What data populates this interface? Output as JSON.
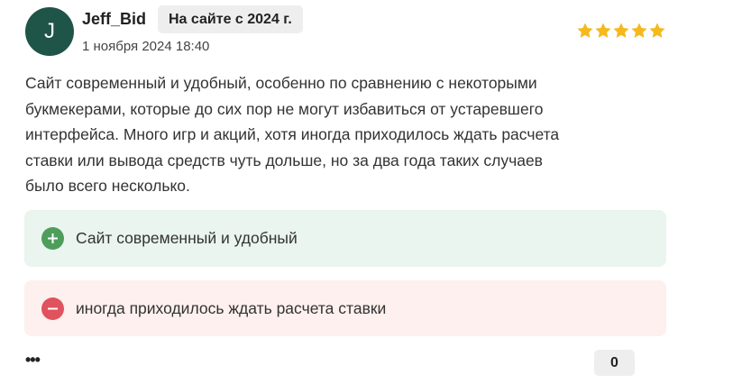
{
  "review": {
    "avatar_letter": "J",
    "avatar_color": "#1f5448",
    "username": "Jeff_Bid",
    "member_since": "На сайте с 2024 г.",
    "date": "1 ноября 2024 18:40",
    "rating": 5,
    "rating_max": 5,
    "star_color": "#f5b91e",
    "text": "Сайт современный и удобный, особенно по сравнению с некоторыми букмекерами, которые до сих пор не могут избавиться от устаревшего интерфейса. Много игр и акций, хотя иногда приходилось ждать расчета ставки или вывода средств чуть дольше, но за два года таких случаев было всего несколько.",
    "pro": {
      "icon": "plus-icon",
      "text": "Сайт современный и удобный",
      "color": "#4d9d5b"
    },
    "con": {
      "icon": "minus-icon",
      "text": "иногда приходилось ждать расчета ставки",
      "color": "#e0525d"
    },
    "more_label": "•••",
    "count": "0"
  }
}
